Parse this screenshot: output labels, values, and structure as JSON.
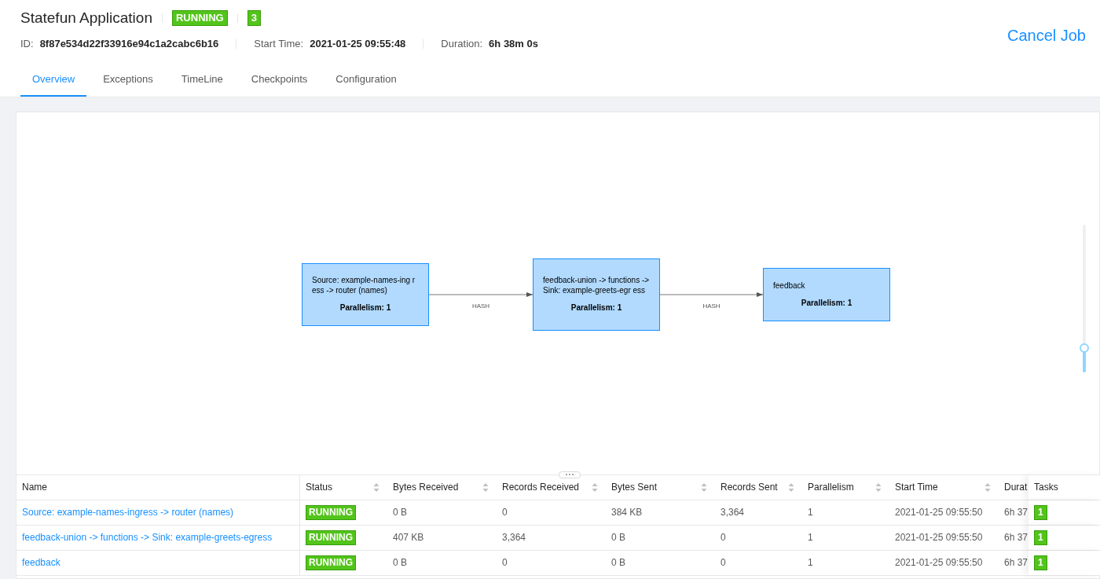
{
  "job": {
    "title": "Statefun Application",
    "status": "RUNNING",
    "task_count": "3",
    "id_label": "ID:",
    "id": "8f87e534d22f33916e94c1a2cabc6b16",
    "start_label": "Start Time:",
    "start": "2021-01-25 09:55:48",
    "duration_label": "Duration:",
    "duration": "6h 38m 0s",
    "cancel": "Cancel Job"
  },
  "tabs": [
    {
      "label": "Overview",
      "selected": true
    },
    {
      "label": "Exceptions",
      "selected": false
    },
    {
      "label": "TimeLine",
      "selected": false
    },
    {
      "label": "Checkpoints",
      "selected": false
    },
    {
      "label": "Configuration",
      "selected": false
    }
  ],
  "graph": {
    "nodes": [
      {
        "text": "Source: example-names-ing ress -> router (names)",
        "parallelism": "Parallelism: 1"
      },
      {
        "text": "feedback-union -> functions -> Sink: example-greets-egr ess",
        "parallelism": "Parallelism: 1"
      },
      {
        "text": "feedback",
        "parallelism": "Parallelism: 1"
      }
    ],
    "edges": [
      {
        "label": "HASH"
      },
      {
        "label": "HASH"
      }
    ],
    "zoom": {
      "level": 0.16
    }
  },
  "table": {
    "columns": [
      {
        "label": "Name",
        "sortable": false
      },
      {
        "label": "Status",
        "sortable": true
      },
      {
        "label": "Bytes Received",
        "sortable": true
      },
      {
        "label": "Records Received",
        "sortable": true
      },
      {
        "label": "Bytes Sent",
        "sortable": true
      },
      {
        "label": "Records Sent",
        "sortable": true
      },
      {
        "label": "Parallelism",
        "sortable": true
      },
      {
        "label": "Start Time",
        "sortable": true
      },
      {
        "label": "Durat",
        "sortable": false
      },
      {
        "label": "Tasks",
        "sortable": false
      }
    ],
    "rows": [
      {
        "cells": [
          "Source: example-names-ingress -> router (names)",
          "RUNNING",
          "0 B",
          "0",
          "384 KB",
          "3,364",
          "1",
          "2021-01-25 09:55:50",
          "6h 37",
          "1"
        ]
      },
      {
        "cells": [
          "feedback-union -> functions -> Sink: example-greets-egress",
          "RUNNING",
          "407 KB",
          "3,364",
          "0 B",
          "0",
          "1",
          "2021-01-25 09:55:50",
          "6h 37",
          "1"
        ]
      },
      {
        "cells": [
          "feedback",
          "RUNNING",
          "0 B",
          "0",
          "0 B",
          "0",
          "1",
          "2021-01-25 09:55:50",
          "6h 37",
          "1"
        ]
      }
    ]
  }
}
